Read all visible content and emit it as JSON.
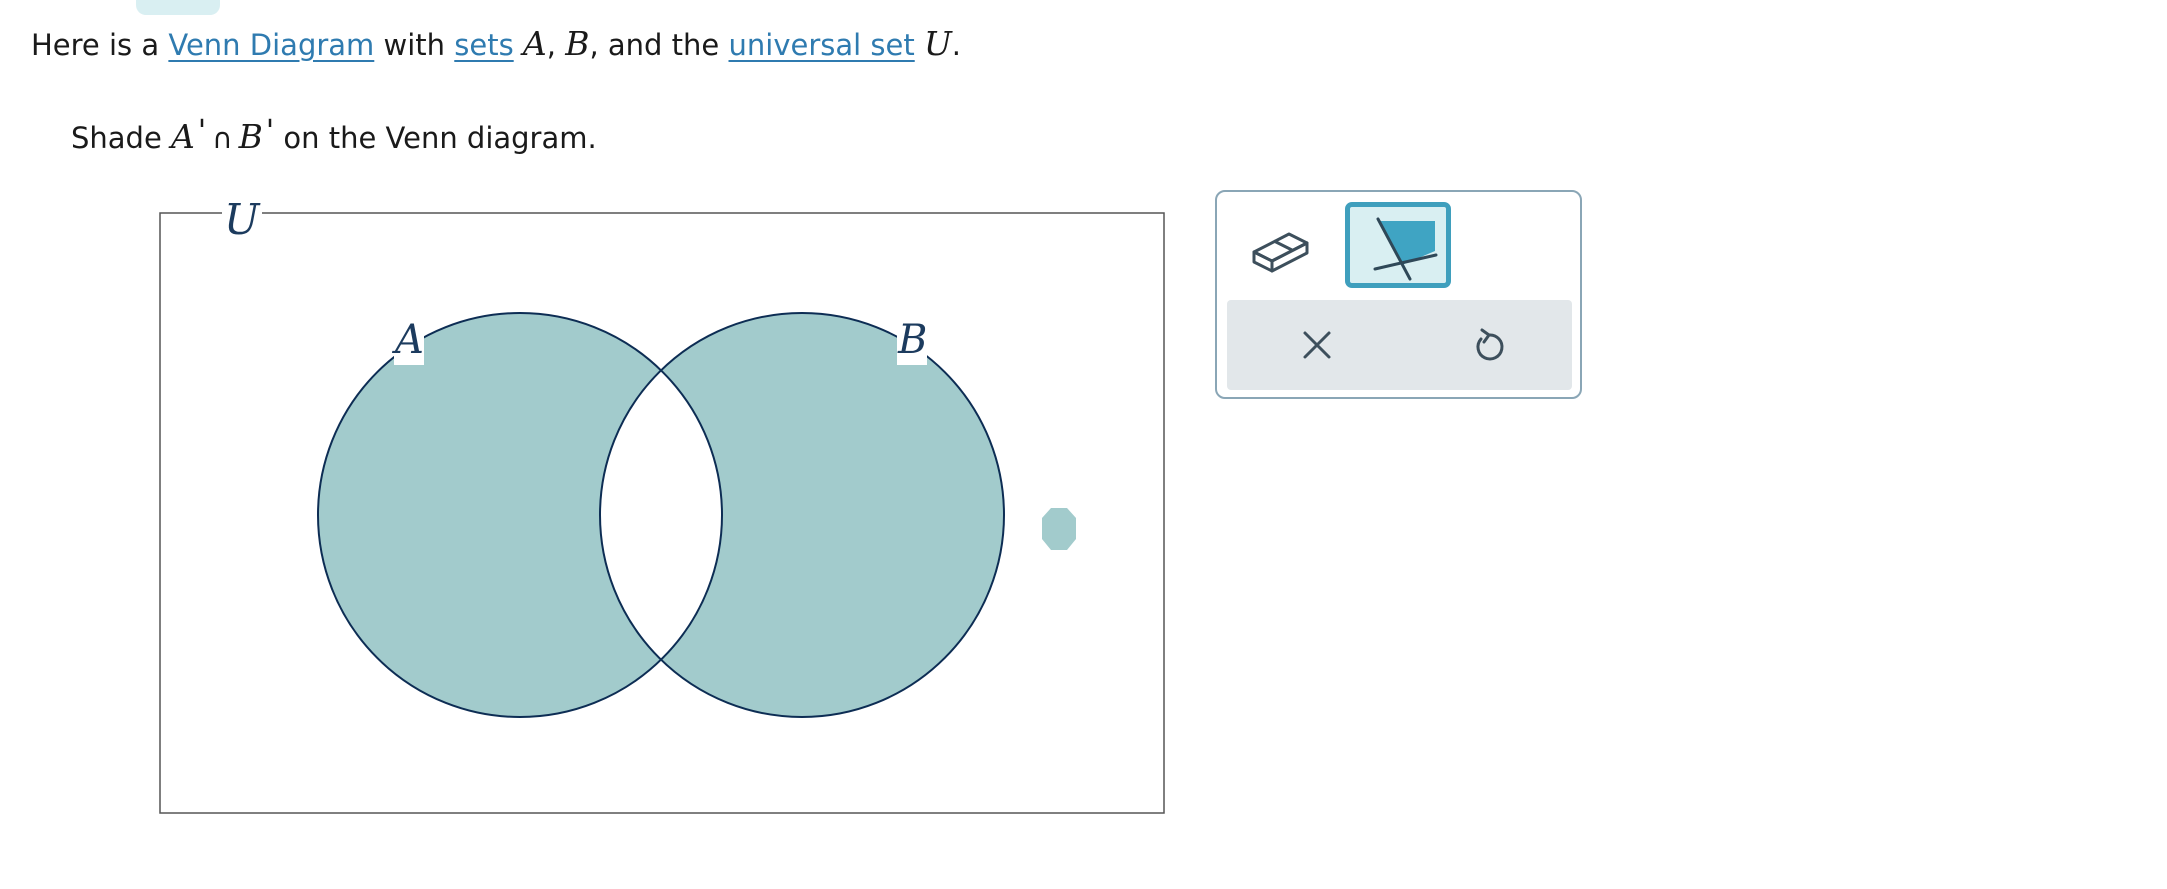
{
  "intro": {
    "prefix": "Here is a ",
    "link_venn": "Venn Diagram",
    "with": " with ",
    "link_sets": "sets",
    "set_a": "A",
    "comma1": ",",
    "set_b": "B",
    "and_the": ", and the ",
    "link_universal": "universal set",
    "set_u": "U",
    "period": "."
  },
  "instruction": {
    "prefix": "Shade ",
    "a": "A",
    "prime_a": "'",
    "cap": "∩",
    "b": "B",
    "prime_b": "'",
    "suffix": " on the Venn diagram."
  },
  "venn": {
    "universe_label": "U",
    "set_a_label": "A",
    "set_b_label": "B",
    "shade_color": "#a2cbcc",
    "outline_color": "#0d2d54",
    "shaded_regions": [
      "A only",
      "B only"
    ],
    "unshaded_regions": [
      "A ∩ B",
      "outside A ∪ B"
    ]
  },
  "tools": {
    "eraser": "eraser-icon",
    "shade": "shade-flag-icon",
    "shade_selected": true,
    "clear": "close-icon",
    "undo": "undo-icon"
  }
}
